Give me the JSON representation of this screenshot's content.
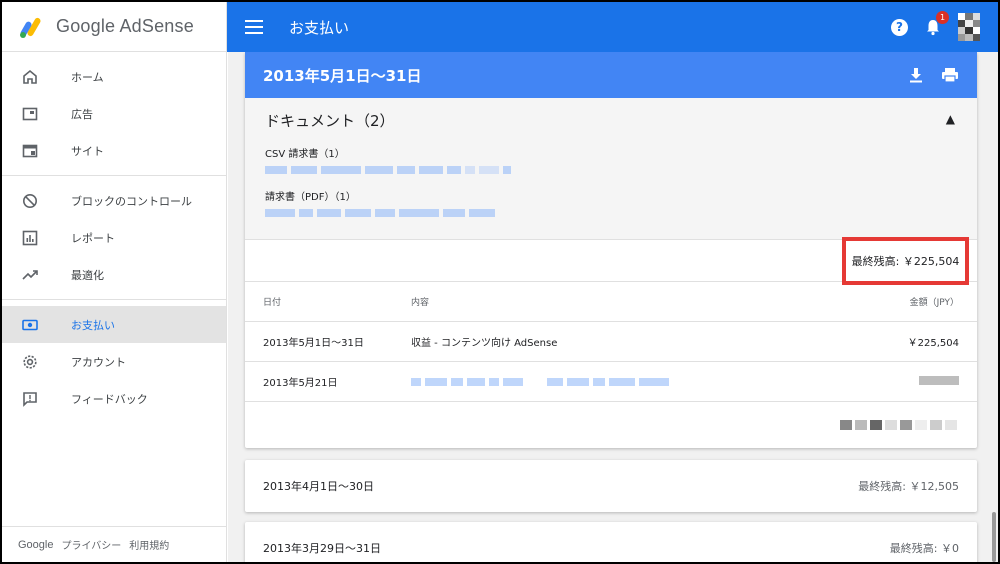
{
  "app": {
    "logo_text": "Google AdSense"
  },
  "topbar": {
    "title": "お支払い",
    "notification_count": "1"
  },
  "sidebar": {
    "groups": [
      [
        {
          "label": "ホーム",
          "icon": "home-icon"
        },
        {
          "label": "広告",
          "icon": "ads-icon"
        },
        {
          "label": "サイト",
          "icon": "sites-icon"
        }
      ],
      [
        {
          "label": "ブロックのコントロール",
          "icon": "block-icon"
        },
        {
          "label": "レポート",
          "icon": "report-icon"
        },
        {
          "label": "最適化",
          "icon": "trending-icon"
        }
      ],
      [
        {
          "label": "お支払い",
          "icon": "payments-icon",
          "active": true
        },
        {
          "label": "アカウント",
          "icon": "settings-icon"
        },
        {
          "label": "フィードバック",
          "icon": "feedback-icon"
        }
      ]
    ],
    "footer": {
      "brand": "Google",
      "privacy": "プライバシー",
      "terms": "利用規約"
    }
  },
  "statement": {
    "period": "2013年5月1日〜31日",
    "documents": {
      "title": "ドキュメント（2）",
      "csv_label": "CSV 請求書（1）",
      "pdf_label": "請求書（PDF）（1）"
    },
    "final_balance": "最終残高: ￥225,504",
    "table": {
      "headers": {
        "date": "日付",
        "description": "内容",
        "amount": "金額（JPY）"
      },
      "rows": [
        {
          "date": "2013年5月1日〜31日",
          "description": "収益 - コンテンツ向け AdSense",
          "amount": "￥225,504"
        },
        {
          "date": "2013年5月21日",
          "description": "",
          "amount": ""
        }
      ]
    }
  },
  "history": [
    {
      "period": "2013年4月1日〜30日",
      "balance": "最終残高: ￥12,505"
    },
    {
      "period": "2013年3月29日〜31日",
      "balance": "最終残高: ￥0"
    }
  ],
  "colors": {
    "primary": "#1a73e8",
    "header_blue": "#4285f4",
    "highlight": "#e53935"
  }
}
